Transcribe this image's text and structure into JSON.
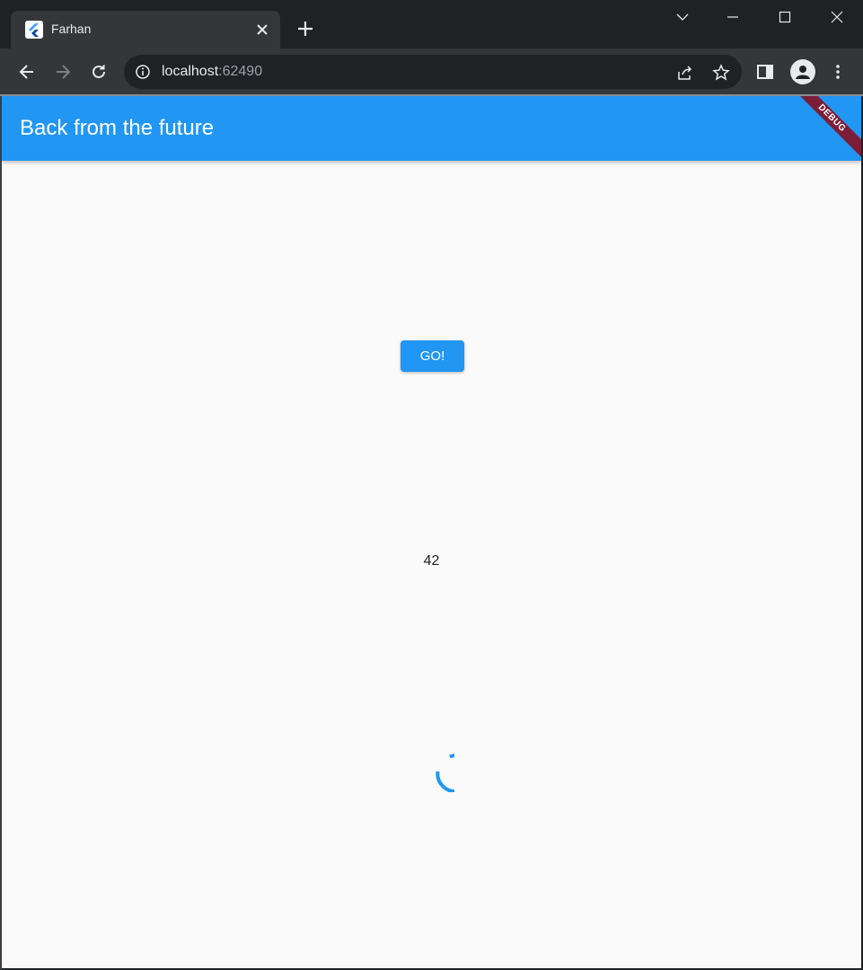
{
  "browser": {
    "tab_title": "Farhan",
    "tab_close_icon": "close-icon",
    "new_tab_icon": "plus-icon",
    "url_host": "localhost",
    "url_port": ":62490"
  },
  "app": {
    "title": "Back from the future",
    "debug_banner": "DEBUG",
    "go_button_label": "GO!",
    "result_value": "42",
    "accent_color": "#2196f3"
  }
}
